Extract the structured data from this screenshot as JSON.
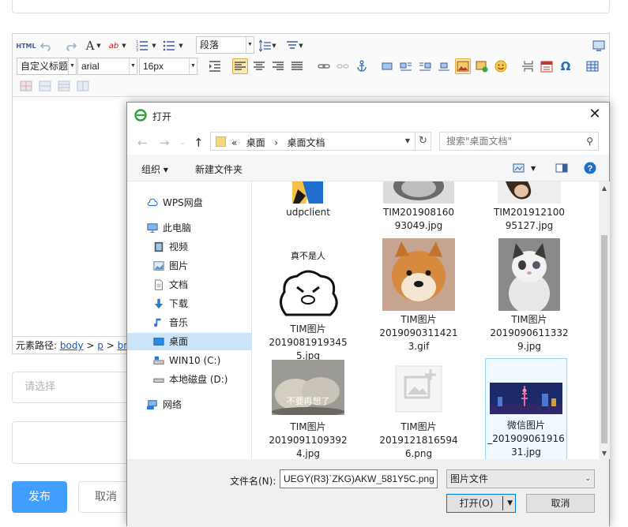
{
  "page": {
    "select_placeholder": "请选择",
    "publish_label": "发布",
    "cancel_label": "取消"
  },
  "editor": {
    "html_label": "HTML",
    "paragraph_format": "段落",
    "font_combo": "自定义标题",
    "font_family": "arial",
    "font_size": "16px",
    "path_label": "元素路径:",
    "path_items": [
      "body",
      "p",
      "br"
    ],
    "path_sep": ">"
  },
  "dialog": {
    "title": "打开",
    "breadcrumb_prefix": "«",
    "breadcrumb": [
      "桌面",
      "桌面文档"
    ],
    "breadcrumb_sep": "›",
    "search_placeholder": "搜索\"桌面文档\"",
    "organize_label": "组织 ▾",
    "new_folder_label": "新建文件夹",
    "nav_items": [
      {
        "label": "WPS网盘",
        "icon": "cloud-icon"
      },
      {
        "label": "此电脑",
        "icon": "computer-icon"
      },
      {
        "label": "视频",
        "icon": "video-icon"
      },
      {
        "label": "图片",
        "icon": "picture-icon"
      },
      {
        "label": "文档",
        "icon": "document-icon"
      },
      {
        "label": "下载",
        "icon": "download-icon"
      },
      {
        "label": "音乐",
        "icon": "music-icon"
      },
      {
        "label": "桌面",
        "icon": "desktop-icon"
      },
      {
        "label": "WIN10 (C:)",
        "icon": "drive-icon"
      },
      {
        "label": "本地磁盘 (D:)",
        "icon": "drive-icon"
      },
      {
        "label": "网络",
        "icon": "network-icon"
      }
    ],
    "files": [
      {
        "line1": "udpclient",
        "line2": "",
        "line3": ""
      },
      {
        "line1": "TIM201908160",
        "line2": "93049.jpg",
        "line3": ""
      },
      {
        "line1": "TIM201912100",
        "line2": "95127.jpg",
        "line3": ""
      },
      {
        "line1": "TIM图片",
        "line2": "2019081919345",
        "line3": "5.jpg"
      },
      {
        "line1": "TIM图片",
        "line2": "2019090311421",
        "line3": "3.gif"
      },
      {
        "line1": "TIM图片",
        "line2": "2019090611332",
        "line3": "9.jpg"
      },
      {
        "line1": "TIM图片",
        "line2": "2019091109392",
        "line3": "4.jpg"
      },
      {
        "line1": "TIM图片",
        "line2": "2019121816594",
        "line3": "6.png"
      },
      {
        "line1": "微信图片",
        "line2": "_201909061916",
        "line3": "31.jpg"
      }
    ],
    "meme_text": "真不是人",
    "thumb_caption": "不要再想了",
    "filename_label": "文件名(N):",
    "filename_value": "UEGY(R3}`ZKG)AKW_581Y5C.png",
    "filetype_value": "图片文件",
    "open_label": "打开(O)",
    "cancel_label": "取消",
    "colors": {
      "selection": "#cce4f7",
      "accent": "#0078d7",
      "publish": "#409eff"
    }
  }
}
